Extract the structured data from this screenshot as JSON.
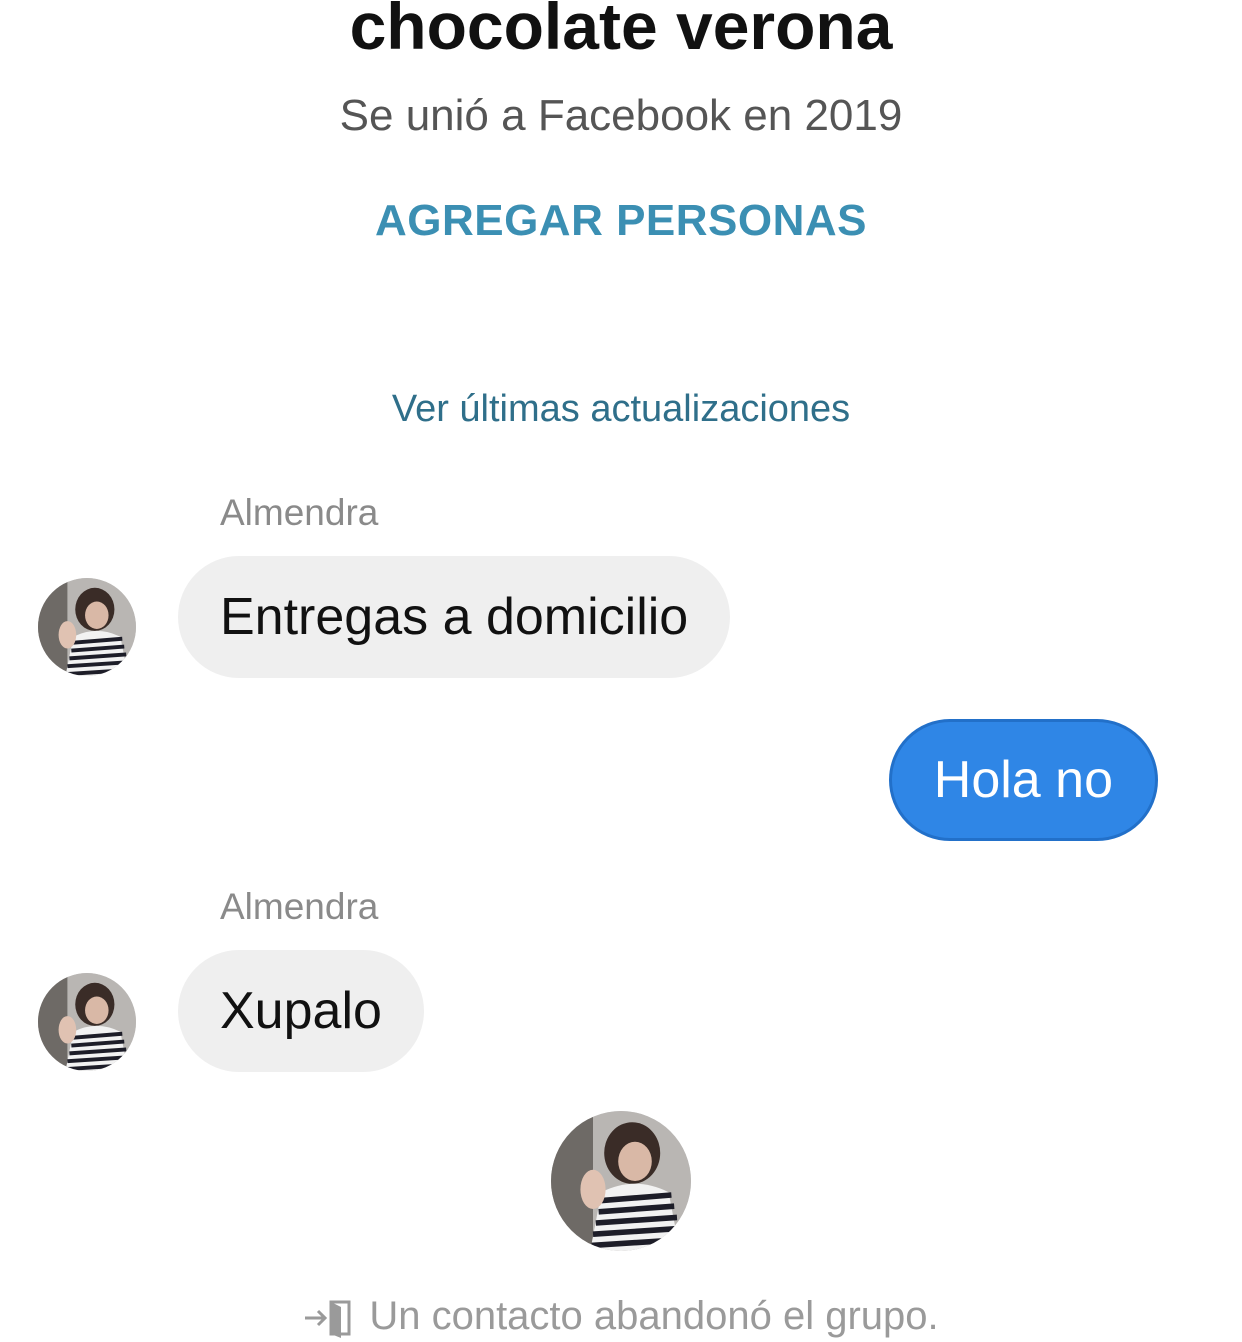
{
  "header": {
    "group_name": "chocolate verona",
    "joined_text": "Se unió a Facebook en 2019",
    "add_people_label": "AGREGAR PERSONAS",
    "updates_link": "Ver últimas actualizaciones"
  },
  "messages": [
    {
      "sender": "Almendra",
      "text": "Entregas a domicilio",
      "direction": "incoming"
    },
    {
      "sender": "",
      "text": "Hola no",
      "direction": "outgoing"
    },
    {
      "sender": "Almendra",
      "text": "Xupalo",
      "direction": "incoming"
    }
  ],
  "system": {
    "icon": "leave-group-icon",
    "text": "Un contacto abandonó el grupo."
  },
  "colors": {
    "outgoing_bubble": "#2f86e6",
    "incoming_bubble": "#efefef",
    "accent_link": "#3b8fb3"
  }
}
